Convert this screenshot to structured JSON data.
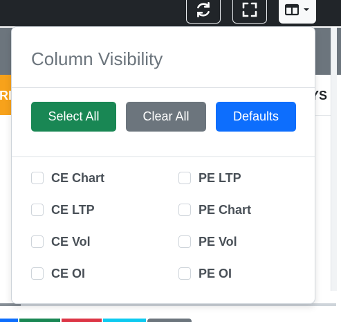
{
  "page": {
    "bg_right_text": "YS",
    "bg_left_text": "RI"
  },
  "toolbar": {
    "buttons": [
      {
        "icon": "refresh-icon"
      },
      {
        "icon": "fullscreen-icon"
      },
      {
        "icon": "columns-icon",
        "caret": "dropdown-caret-icon"
      }
    ]
  },
  "column_visibility": {
    "title": "Column Visibility",
    "select_all": "Select All",
    "clear_all": "Clear All",
    "defaults": "Defaults",
    "options": [
      {
        "label": "CE Chart",
        "checked": false
      },
      {
        "label": "PE LTP",
        "checked": false
      },
      {
        "label": "CE LTP",
        "checked": false
      },
      {
        "label": "PE Chart",
        "checked": false
      },
      {
        "label": "CE Vol",
        "checked": false
      },
      {
        "label": "PE Vol",
        "checked": false
      },
      {
        "label": "CE OI",
        "checked": false
      },
      {
        "label": "PE OI",
        "checked": false
      }
    ]
  },
  "colors": {
    "success": "#198754",
    "secondary": "#6c757d",
    "primary": "#0d6efd",
    "warning": "#f7a21b"
  }
}
